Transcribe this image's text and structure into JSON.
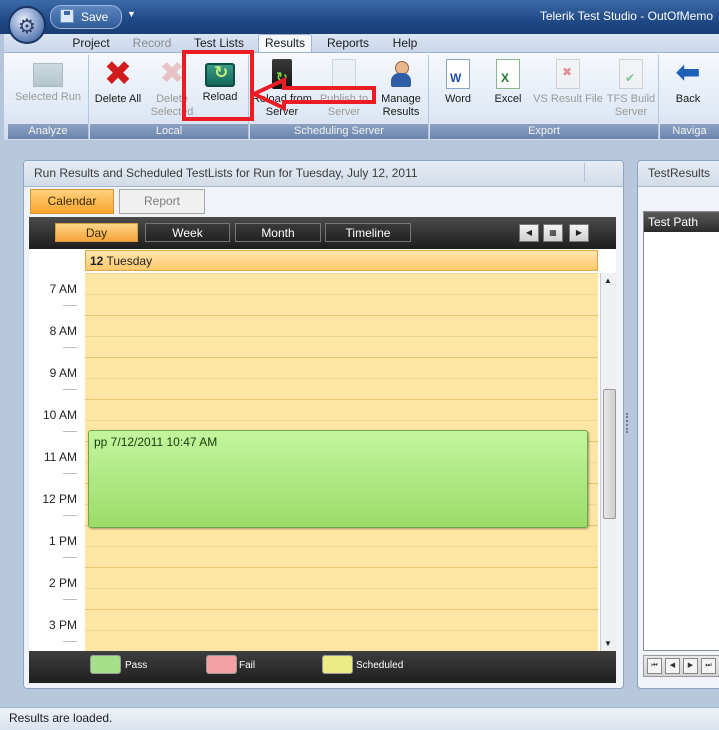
{
  "window": {
    "title": "Telerik Test Studio - OutOfMemo",
    "quick_access": {
      "save_label": "Save"
    }
  },
  "ribbon_tabs": [
    {
      "label": "Project",
      "state": "normal"
    },
    {
      "label": "Record",
      "state": "disabled"
    },
    {
      "label": "Test Lists",
      "state": "normal"
    },
    {
      "label": "Results",
      "state": "active"
    },
    {
      "label": "Reports",
      "state": "normal"
    },
    {
      "label": "Help",
      "state": "normal"
    }
  ],
  "ribbon_groups": {
    "analyze": {
      "label": "Analyze",
      "buttons": [
        {
          "label": "Selected Run",
          "icon": "selected-run-icon",
          "enabled": false
        }
      ]
    },
    "local": {
      "label": "Local",
      "buttons": [
        {
          "label": "Delete All",
          "icon": "delete-all-icon",
          "enabled": true
        },
        {
          "label": "Delete Selected",
          "icon": "delete-selected-icon",
          "enabled": false
        },
        {
          "label": "Reload",
          "icon": "reload-icon",
          "enabled": true
        }
      ]
    },
    "scheduling_server": {
      "label": "Scheduling Server",
      "buttons": [
        {
          "label": "Reload from Server",
          "icon": "reload-server-icon",
          "enabled": true
        },
        {
          "label": "Publish to Server",
          "icon": "publish-server-icon",
          "enabled": false
        },
        {
          "label": "Manage Results",
          "icon": "manage-results-icon",
          "enabled": true
        }
      ]
    },
    "export": {
      "label": "Export",
      "buttons": [
        {
          "label": "Word",
          "icon": "word-icon",
          "enabled": true
        },
        {
          "label": "Excel",
          "icon": "excel-icon",
          "enabled": true
        },
        {
          "label": "VS Result File",
          "icon": "vs-result-file-icon",
          "enabled": false
        },
        {
          "label": "TFS Build Server",
          "icon": "tfs-build-server-icon",
          "enabled": false
        }
      ]
    },
    "navigate": {
      "label": "Naviga",
      "buttons": [
        {
          "label": "Back",
          "icon": "back-arrow-icon",
          "enabled": true
        }
      ]
    }
  },
  "annotation": {
    "highlight_color": "#ec1c24"
  },
  "main_panel": {
    "title": "Run Results and Scheduled TestLists for Run for Tuesday, July 12, 2011",
    "subtabs": [
      {
        "label": "Calendar",
        "active": true
      },
      {
        "label": "Report",
        "active": false
      }
    ],
    "views": [
      {
        "label": "Day",
        "active": true
      },
      {
        "label": "Week",
        "active": false
      },
      {
        "label": "Month",
        "active": false
      },
      {
        "label": "Timeline",
        "active": false
      }
    ],
    "day_header": {
      "day_number": "12",
      "day_name": "Tuesday"
    },
    "time_slots": [
      "7 AM",
      "8 AM",
      "9 AM",
      "10 AM",
      "11 AM",
      "12 PM",
      "1 PM",
      "2 PM",
      "3 PM"
    ],
    "appointment": {
      "text": "pp 7/12/2011 10:47 AM",
      "color": "#a8e37a"
    },
    "legend": [
      {
        "label": "Pass",
        "color": "#a6e08a"
      },
      {
        "label": "Fail",
        "color": "#f3a0a0"
      },
      {
        "label": "Scheduled",
        "color": "#ecec86"
      }
    ]
  },
  "right_panel": {
    "title": "TestResults",
    "column_header": "Test Path"
  },
  "status": {
    "text": "Results are loaded."
  },
  "colors": {
    "accent_orange": "#f7a52c",
    "ribbon_blue": "#1f4a86"
  }
}
